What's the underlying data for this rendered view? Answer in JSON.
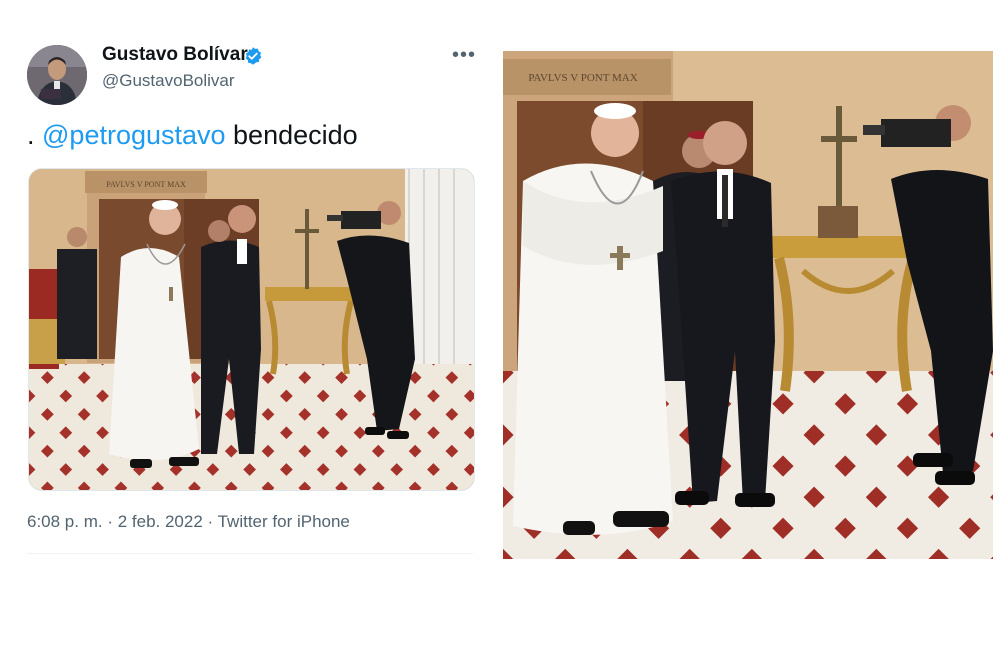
{
  "tweet": {
    "author_name": "Gustavo Bolívar",
    "author_handle": "@GustavoBolivar",
    "verified": true,
    "more_icon": "more-horizontal-icon",
    "text_prefix": ". ",
    "mention": "@petrogustavo",
    "text_suffix": " bendecido",
    "timestamp": "6:08 p. m.",
    "separator": " · ",
    "date": "2 feb. 2022",
    "source": "Twitter for iPhone",
    "media_inscription": "PAVLVS V PONT MAX"
  },
  "photo_right": {
    "inscription": "PAVLVS V PONT MAX"
  },
  "colors": {
    "link_blue": "#1d9bf0",
    "secondary_text": "#536471",
    "verified_blue": "#1d9bf0"
  }
}
